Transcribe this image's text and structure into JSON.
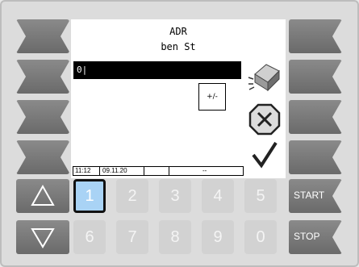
{
  "screen": {
    "title_line1": "ADR",
    "title_line2": "ben St",
    "input_value": "0|",
    "sign_button_label": "+/-"
  },
  "status_bar": {
    "time": "11:12",
    "date": "09.11.20",
    "field3": "",
    "field4": "--"
  },
  "keypad": {
    "row1": [
      "1",
      "2",
      "3",
      "4",
      "5"
    ],
    "row2": [
      "6",
      "7",
      "8",
      "9",
      "0"
    ],
    "selected_key": "1"
  },
  "right_buttons": {
    "start_label": "START",
    "stop_label": "STOP"
  },
  "icons": {
    "eraser": "eraser-icon",
    "cancel": "cancel-x-icon",
    "confirm": "checkmark-icon",
    "up": "triangle-up-icon",
    "down": "triangle-down-icon"
  },
  "colors": {
    "button_gray": "#7a7a7a",
    "screen_bg": "#ffffff",
    "input_bg": "#000000",
    "active_key": "#a9d3f5"
  }
}
